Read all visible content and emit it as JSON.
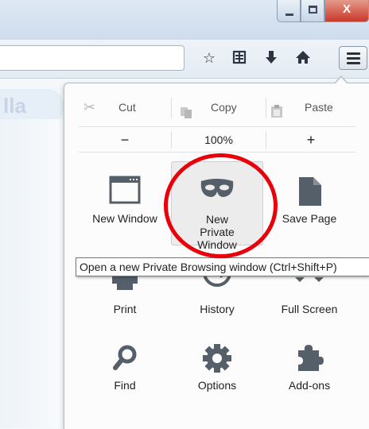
{
  "toolbar": {
    "icons": [
      "star-icon",
      "reading-list-icon",
      "download-icon",
      "home-icon",
      "menu-icon"
    ]
  },
  "page": {
    "logo_text": "lla"
  },
  "menu": {
    "edit": {
      "cut": "Cut",
      "copy": "Copy",
      "paste": "Paste"
    },
    "zoom": {
      "minus": "−",
      "level": "100%",
      "plus": "+"
    },
    "tiles": {
      "new_window": "New Window",
      "new_private_window": "New Private Window",
      "save_page": "Save Page",
      "print": "Print",
      "history": "History",
      "full_screen": "Full Screen",
      "find": "Find",
      "options": "Options",
      "addons": "Add-ons"
    }
  },
  "tooltip": {
    "text": "Open a new Private Browsing window (Ctrl+Shift+P)"
  },
  "colors": {
    "highlight_ring": "#e8000b",
    "icon": "#555f69"
  }
}
